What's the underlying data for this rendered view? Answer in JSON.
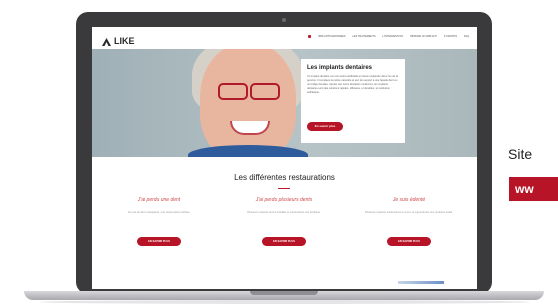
{
  "site": {
    "logo": {
      "name": "LIKE",
      "sub": "Dentistry"
    },
    "nav": [
      "IMPLANTS DENTAIRES",
      "LES TRAITEMENTS",
      "L'INTERVENTION",
      "OBTENIR UN IMPLANT",
      "À PROPOS",
      "FAQ"
    ],
    "hero": {
      "title": "Les implants dentaires",
      "text": "Un implant dentaire est une racine artificielle en titane implantée dans l'os de la gencive. Il remplace la racine naturelle et sert de support à une façade dent ou un bridge dentaire. Ajouter aux soins dentaires modernes, les implants dentaires sont des solutions rapides, efficaces, et durables, et restitution esthétique.",
      "button": "En savoir plus"
    },
    "section_title": "Les différentes restaurations",
    "columns": [
      {
        "title": "J'ai perdu une dent",
        "text": "En cas de dent manquante, une seule petite prothèse",
        "button": "EN SAVOIR PLUS"
      },
      {
        "title": "J'ai perdu plusieurs dents",
        "text": "Plusieurs implants seront installés et soutiendront une prothèse.",
        "button": "EN SAVOIR PLUS"
      },
      {
        "title": "Je suis édenté",
        "text": "Plusieurs implants soutiendront un pont, et supporteront une prothèse totale.",
        "button": "EN SAVOIR PLUS"
      }
    ]
  },
  "side": {
    "text": "Site",
    "banner": "ww"
  },
  "colors": {
    "accent": "#b71427",
    "laptop": "#3a3a3c",
    "hero_bg": "#b6c3c7"
  }
}
